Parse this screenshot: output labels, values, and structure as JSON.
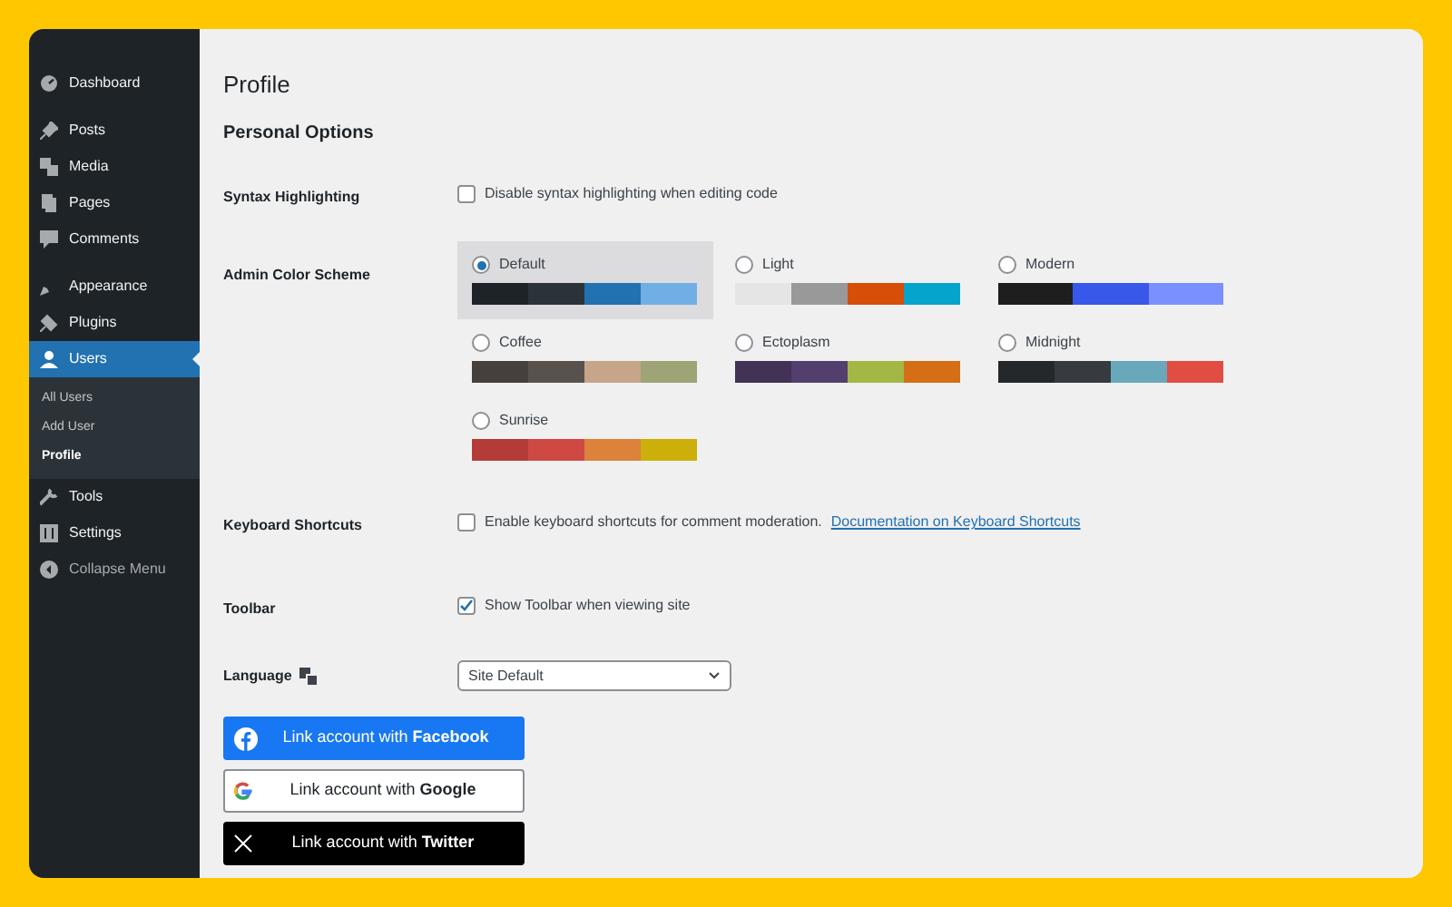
{
  "sidebar": {
    "sections": [
      [
        {
          "kind": "dashboard",
          "label": "Dashboard",
          "selected": false
        }
      ],
      [
        {
          "kind": "posts",
          "label": "Posts",
          "selected": false
        },
        {
          "kind": "media",
          "label": "Media",
          "selected": false
        },
        {
          "kind": "pages",
          "label": "Pages",
          "selected": false
        },
        {
          "kind": "comments",
          "label": "Comments",
          "selected": false
        }
      ],
      [
        {
          "kind": "appearance",
          "label": "Appearance",
          "selected": false
        },
        {
          "kind": "plugins",
          "label": "Plugins",
          "selected": false
        },
        {
          "kind": "users",
          "label": "Users",
          "selected": true,
          "children": [
            {
              "label": "All Users",
              "selected": false
            },
            {
              "label": "Add User",
              "selected": false
            },
            {
              "label": "Profile",
              "selected": true
            }
          ]
        },
        {
          "kind": "tools",
          "label": "Tools",
          "selected": false
        },
        {
          "kind": "settings",
          "label": "Settings",
          "selected": false
        },
        {
          "kind": "collapse",
          "label": "Collapse Menu",
          "selected": false
        }
      ]
    ]
  },
  "page": {
    "title": "Profile",
    "section": "Personal Options",
    "syntax": {
      "label": "Syntax Highlighting",
      "option": "Disable syntax highlighting when editing code",
      "checked": false
    },
    "color_scheme": {
      "label": "Admin Color Scheme",
      "schemes": [
        {
          "name": "Default",
          "selected": true,
          "swatches": [
            {
              "color": "#1d2327"
            },
            {
              "color": "#2c3338"
            },
            {
              "color": "#2271b1"
            },
            {
              "color": "#72aee6"
            }
          ]
        },
        {
          "name": "Light",
          "selected": false,
          "swatches": [
            {
              "color": "#e5e5e5"
            },
            {
              "color": "#999999"
            },
            {
              "color": "#d64e07"
            },
            {
              "color": "#04a4cc"
            }
          ]
        },
        {
          "name": "Modern",
          "selected": false,
          "swatches": [
            {
              "color": "#1e1e1e"
            },
            {
              "color": "#3858e9"
            },
            {
              "color": "#7b90ff"
            }
          ]
        },
        {
          "name": "Coffee",
          "selected": false,
          "swatches": [
            {
              "color": "#46403c"
            },
            {
              "color": "#59524c"
            },
            {
              "color": "#c7a589"
            },
            {
              "color": "#9ea476"
            }
          ]
        },
        {
          "name": "Ectoplasm",
          "selected": false,
          "swatches": [
            {
              "color": "#413256"
            },
            {
              "color": "#523f6d"
            },
            {
              "color": "#a3b745"
            },
            {
              "color": "#d46f15"
            }
          ]
        },
        {
          "name": "Midnight",
          "selected": false,
          "swatches": [
            {
              "color": "#25282b"
            },
            {
              "color": "#363b3f"
            },
            {
              "color": "#69a8bb"
            },
            {
              "color": "#e14d43"
            }
          ]
        },
        {
          "name": "Sunrise",
          "selected": false,
          "swatches": [
            {
              "color": "#b43c38"
            },
            {
              "color": "#cf4944"
            },
            {
              "color": "#dd823b"
            },
            {
              "color": "#ccaf0b"
            }
          ]
        }
      ]
    },
    "keyboard": {
      "label": "Keyboard Shortcuts",
      "option": "Enable keyboard shortcuts for comment moderation.",
      "link": "Documentation on Keyboard Shortcuts",
      "checked": false
    },
    "toolbar": {
      "label": "Toolbar",
      "option": "Show Toolbar when viewing site",
      "checked": true
    },
    "language": {
      "label": "Language",
      "value": "Site Default"
    },
    "social_buttons": [
      {
        "kind": "facebook",
        "text": "Link account with **Facebook**"
      },
      {
        "kind": "google",
        "text": "Link account with **Google**"
      },
      {
        "kind": "twitter",
        "text": "Link account with **Twitter**"
      }
    ]
  }
}
